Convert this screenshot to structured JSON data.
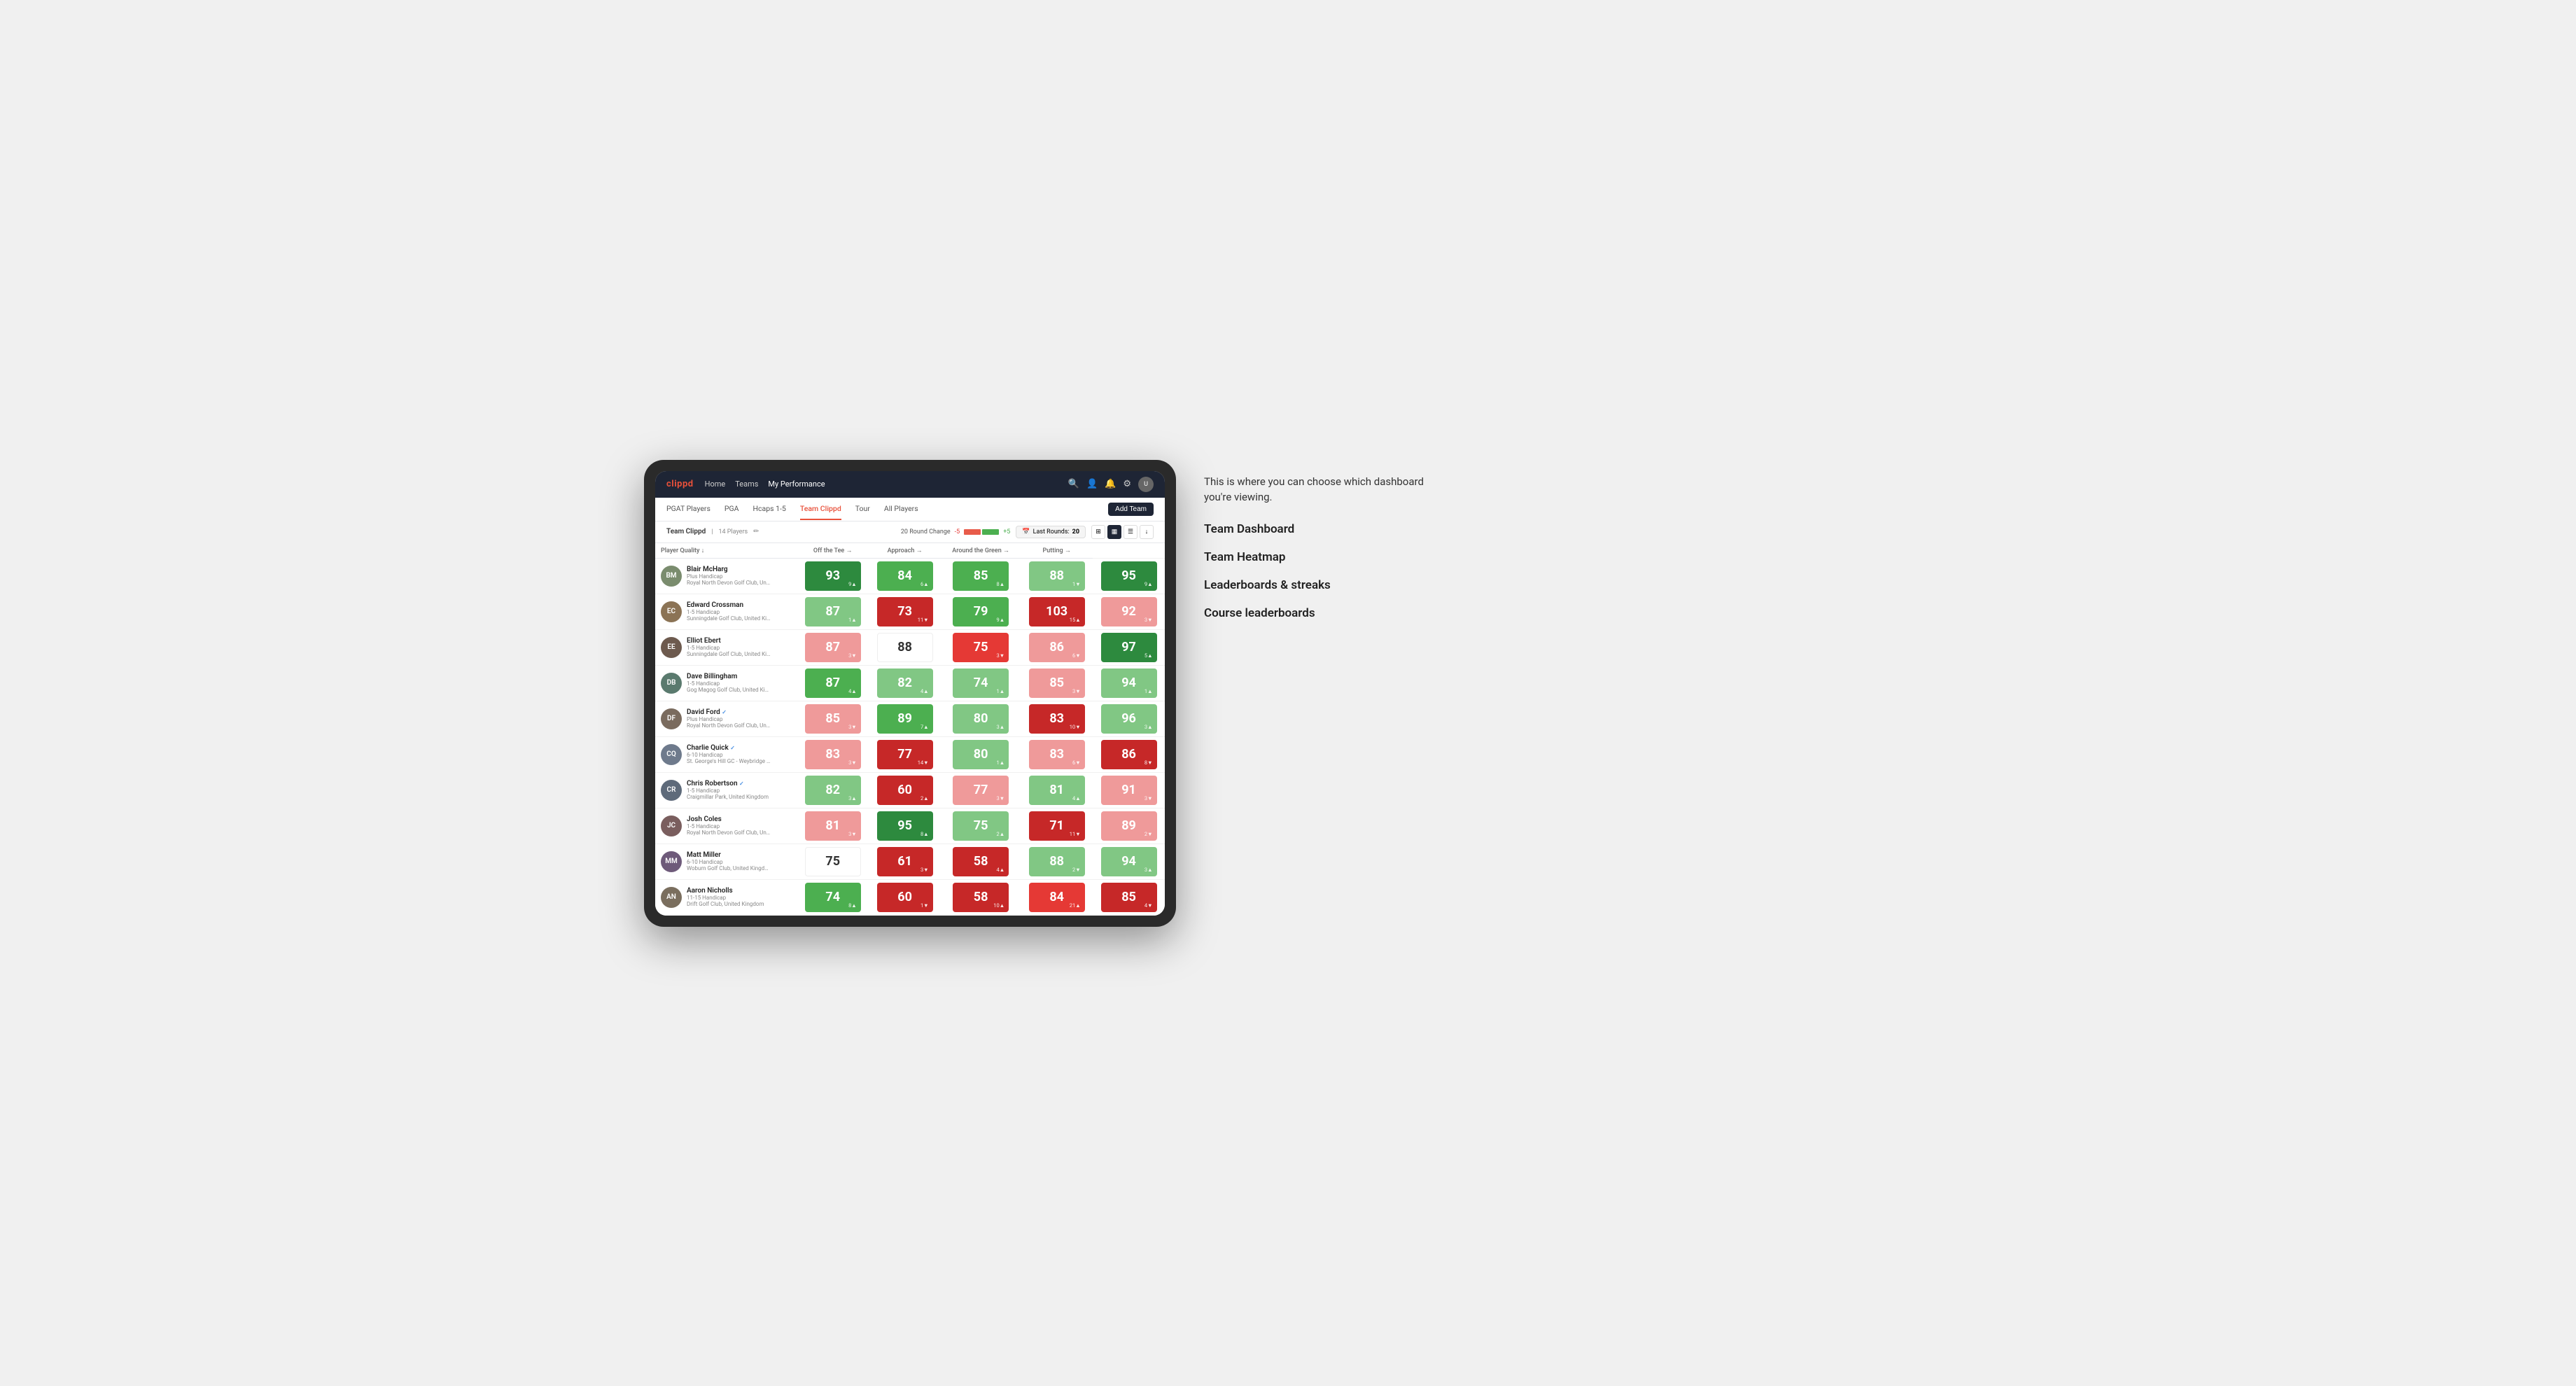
{
  "annotation": {
    "intro_text": "This is where you can choose which dashboard you're viewing.",
    "items": [
      "Team Dashboard",
      "Team Heatmap",
      "Leaderboards & streaks",
      "Course leaderboards"
    ]
  },
  "nav": {
    "logo": "clippd",
    "links": [
      "Home",
      "Teams",
      "My Performance"
    ],
    "active_link": "My Performance"
  },
  "sub_nav": {
    "links": [
      "PGAT Players",
      "PGA",
      "Hcaps 1-5",
      "Team Clippd",
      "Tour",
      "All Players"
    ],
    "active": "Team Clippd",
    "add_team_label": "Add Team"
  },
  "team_header": {
    "team_name": "Team Clippd",
    "separator": "|",
    "player_count": "14 Players",
    "round_change_label": "20 Round Change",
    "minus_val": "-5",
    "plus_val": "+5",
    "last_rounds_label": "Last Rounds:",
    "last_rounds_val": "20"
  },
  "table": {
    "columns": [
      "Player Quality ↓",
      "Off the Tee →",
      "Approach →",
      "Around the Green →",
      "Putting →"
    ],
    "rows": [
      {
        "name": "Blair McHarg",
        "handicap": "Plus Handicap",
        "club": "Royal North Devon Golf Club, United Kingdom",
        "avatar_initials": "BM",
        "avatar_color": "#7a8c6e",
        "scores": [
          {
            "value": "93",
            "delta": "9▲",
            "bg": "bg-green-dark"
          },
          {
            "value": "84",
            "delta": "6▲",
            "bg": "bg-green-med"
          },
          {
            "value": "85",
            "delta": "8▲",
            "bg": "bg-green-med"
          },
          {
            "value": "88",
            "delta": "1▼",
            "bg": "bg-green-light"
          },
          {
            "value": "95",
            "delta": "9▲",
            "bg": "bg-green-dark"
          }
        ]
      },
      {
        "name": "Edward Crossman",
        "handicap": "1-5 Handicap",
        "club": "Sunningdale Golf Club, United Kingdom",
        "avatar_initials": "EC",
        "avatar_color": "#8B7355",
        "scores": [
          {
            "value": "87",
            "delta": "1▲",
            "bg": "bg-green-light"
          },
          {
            "value": "73",
            "delta": "11▼",
            "bg": "bg-red-dark"
          },
          {
            "value": "79",
            "delta": "9▲",
            "bg": "bg-green-med"
          },
          {
            "value": "103",
            "delta": "15▲",
            "bg": "bg-red-dark"
          },
          {
            "value": "92",
            "delta": "3▼",
            "bg": "bg-red-light"
          }
        ]
      },
      {
        "name": "Elliot Ebert",
        "handicap": "1-5 Handicap",
        "club": "Sunningdale Golf Club, United Kingdom",
        "avatar_initials": "EE",
        "avatar_color": "#6d5a4e",
        "scores": [
          {
            "value": "87",
            "delta": "3▼",
            "bg": "bg-red-light"
          },
          {
            "value": "88",
            "delta": "",
            "bg": "bg-white"
          },
          {
            "value": "75",
            "delta": "3▼",
            "bg": "bg-red-med"
          },
          {
            "value": "86",
            "delta": "6▼",
            "bg": "bg-red-light"
          },
          {
            "value": "97",
            "delta": "5▲",
            "bg": "bg-green-dark"
          }
        ]
      },
      {
        "name": "Dave Billingham",
        "handicap": "1-5 Handicap",
        "club": "Gog Magog Golf Club, United Kingdom",
        "avatar_initials": "DB",
        "avatar_color": "#5a7a6e",
        "scores": [
          {
            "value": "87",
            "delta": "4▲",
            "bg": "bg-green-med"
          },
          {
            "value": "82",
            "delta": "4▲",
            "bg": "bg-green-light"
          },
          {
            "value": "74",
            "delta": "1▲",
            "bg": "bg-green-light"
          },
          {
            "value": "85",
            "delta": "3▼",
            "bg": "bg-red-light"
          },
          {
            "value": "94",
            "delta": "1▲",
            "bg": "bg-green-light"
          }
        ]
      },
      {
        "name": "David Ford",
        "handicap": "Plus Handicap",
        "club": "Royal North Devon Golf Club, United Kingdom",
        "avatar_initials": "DF",
        "avatar_color": "#7a6b5e",
        "verified": true,
        "scores": [
          {
            "value": "85",
            "delta": "3▼",
            "bg": "bg-red-light"
          },
          {
            "value": "89",
            "delta": "7▲",
            "bg": "bg-green-med"
          },
          {
            "value": "80",
            "delta": "3▲",
            "bg": "bg-green-light"
          },
          {
            "value": "83",
            "delta": "10▼",
            "bg": "bg-red-dark"
          },
          {
            "value": "96",
            "delta": "3▲",
            "bg": "bg-green-light"
          }
        ]
      },
      {
        "name": "Charlie Quick",
        "handicap": "6-10 Handicap",
        "club": "St. George's Hill GC - Weybridge - Surrey, Uni...",
        "avatar_initials": "CQ",
        "avatar_color": "#6e7a8c",
        "verified": true,
        "scores": [
          {
            "value": "83",
            "delta": "3▼",
            "bg": "bg-red-light"
          },
          {
            "value": "77",
            "delta": "14▼",
            "bg": "bg-red-dark"
          },
          {
            "value": "80",
            "delta": "1▲",
            "bg": "bg-green-light"
          },
          {
            "value": "83",
            "delta": "6▼",
            "bg": "bg-red-light"
          },
          {
            "value": "86",
            "delta": "8▼",
            "bg": "bg-red-dark"
          }
        ]
      },
      {
        "name": "Chris Robertson",
        "handicap": "1-5 Handicap",
        "club": "Craigmillar Park, United Kingdom",
        "avatar_initials": "CR",
        "avatar_color": "#5e6a7a",
        "verified": true,
        "scores": [
          {
            "value": "82",
            "delta": "3▲",
            "bg": "bg-green-light"
          },
          {
            "value": "60",
            "delta": "2▲",
            "bg": "bg-red-dark"
          },
          {
            "value": "77",
            "delta": "3▼",
            "bg": "bg-red-light"
          },
          {
            "value": "81",
            "delta": "4▲",
            "bg": "bg-green-light"
          },
          {
            "value": "91",
            "delta": "3▼",
            "bg": "bg-red-light"
          }
        ]
      },
      {
        "name": "Josh Coles",
        "handicap": "1-5 Handicap",
        "club": "Royal North Devon Golf Club, United Kingdom",
        "avatar_initials": "JC",
        "avatar_color": "#7a5e5e",
        "scores": [
          {
            "value": "81",
            "delta": "3▼",
            "bg": "bg-red-light"
          },
          {
            "value": "95",
            "delta": "8▲",
            "bg": "bg-green-dark"
          },
          {
            "value": "75",
            "delta": "2▲",
            "bg": "bg-green-light"
          },
          {
            "value": "71",
            "delta": "11▼",
            "bg": "bg-red-dark"
          },
          {
            "value": "89",
            "delta": "2▼",
            "bg": "bg-red-light"
          }
        ]
      },
      {
        "name": "Matt Miller",
        "handicap": "6-10 Handicap",
        "club": "Woburn Golf Club, United Kingdom",
        "avatar_initials": "MM",
        "avatar_color": "#6e5a7a",
        "scores": [
          {
            "value": "75",
            "delta": "",
            "bg": "bg-white"
          },
          {
            "value": "61",
            "delta": "3▼",
            "bg": "bg-red-dark"
          },
          {
            "value": "58",
            "delta": "4▲",
            "bg": "bg-red-dark"
          },
          {
            "value": "88",
            "delta": "2▼",
            "bg": "bg-green-light"
          },
          {
            "value": "94",
            "delta": "3▲",
            "bg": "bg-green-light"
          }
        ]
      },
      {
        "name": "Aaron Nicholls",
        "handicap": "11-15 Handicap",
        "club": "Drift Golf Club, United Kingdom",
        "avatar_initials": "AN",
        "avatar_color": "#7a6e5e",
        "scores": [
          {
            "value": "74",
            "delta": "8▲",
            "bg": "bg-green-med"
          },
          {
            "value": "60",
            "delta": "1▼",
            "bg": "bg-red-dark"
          },
          {
            "value": "58",
            "delta": "10▲",
            "bg": "bg-red-dark"
          },
          {
            "value": "84",
            "delta": "21▲",
            "bg": "bg-red-med"
          },
          {
            "value": "85",
            "delta": "4▼",
            "bg": "bg-red-dark"
          }
        ]
      }
    ]
  }
}
